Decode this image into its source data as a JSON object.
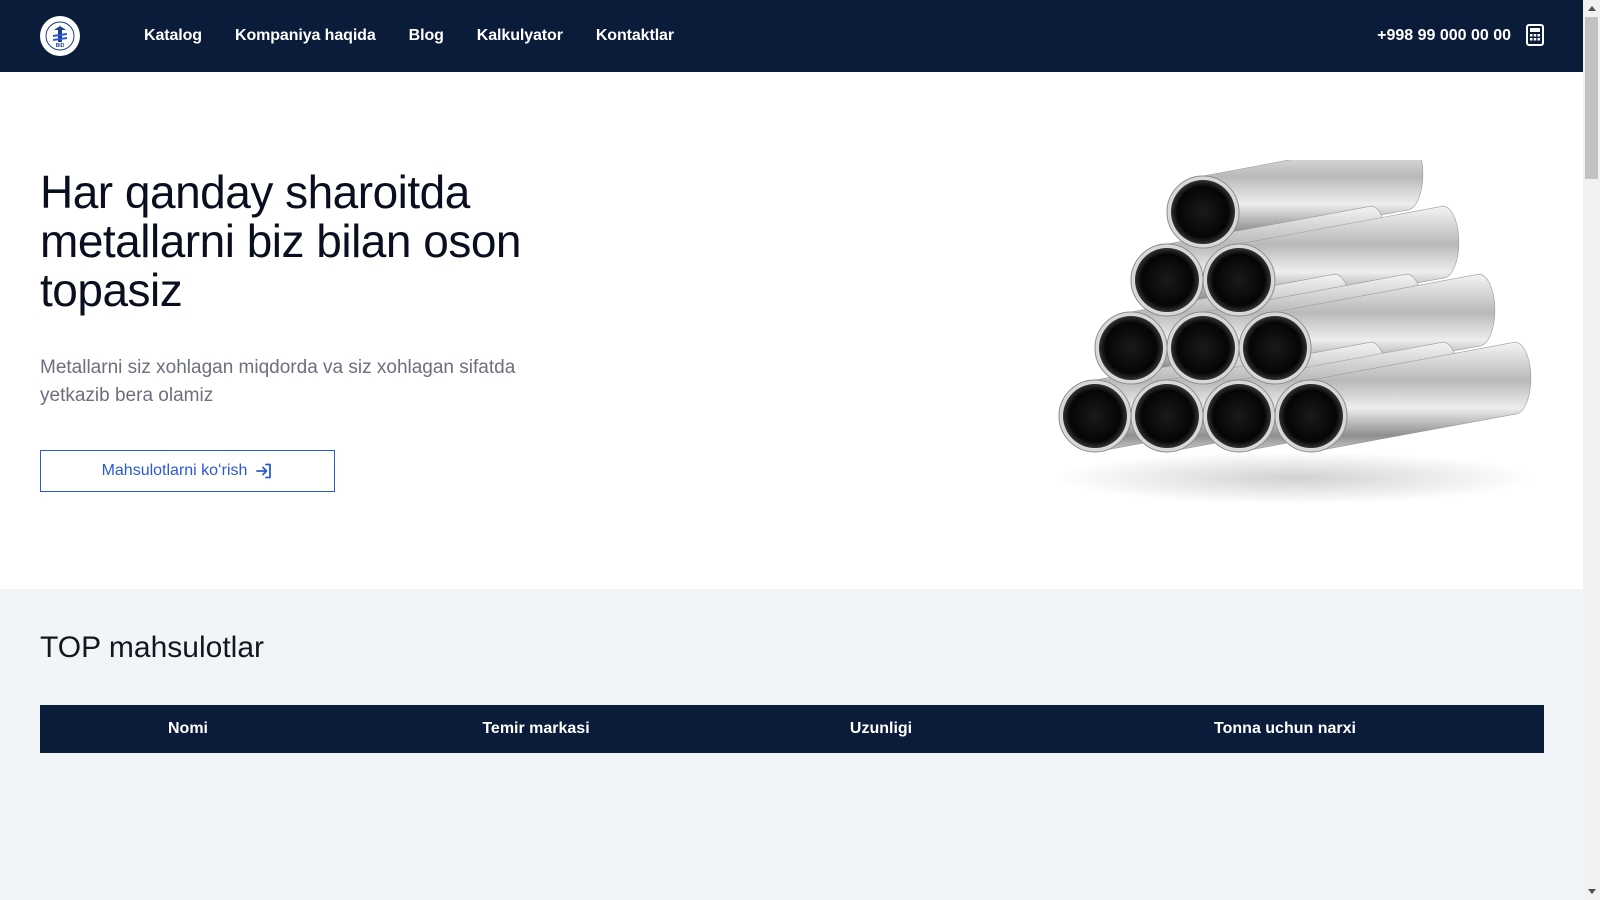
{
  "header": {
    "nav": [
      {
        "label": "Katalog"
      },
      {
        "label": "Kompaniya haqida"
      },
      {
        "label": "Blog"
      },
      {
        "label": "Kalkulyator"
      },
      {
        "label": "Kontaktlar"
      }
    ],
    "phone": "+998 99 000 00 00",
    "logo_icon": "company-logo",
    "calculator_icon": "calculator-icon"
  },
  "hero": {
    "title": "Har qanday sharoitda metallarni biz bilan oson topasiz",
    "subtitle": "Metallarni siz xohlagan miqdorda va siz xohlagan sifatda yetkazib bera olamiz",
    "button_label": "Mahsulotlarni koʻrish",
    "button_icon": "sign-in-arrow-icon",
    "image": "steel-pipes-stack"
  },
  "top_products": {
    "title": "TOP mahsulotlar",
    "columns": [
      "Nomi",
      "Temir markasi",
      "Uzunligi",
      "Tonna uchun narxi"
    ]
  },
  "colors": {
    "header_bg": "#0b1b3a",
    "accent": "#2c58d6",
    "section_bg": "#f2f5f7"
  }
}
